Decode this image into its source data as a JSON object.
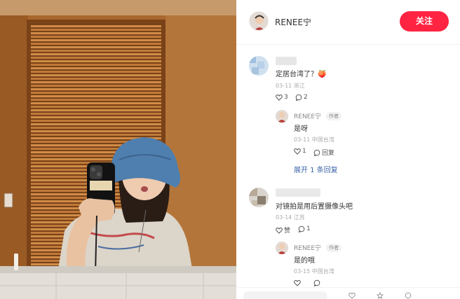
{
  "header": {
    "author_name": "RENEE宁",
    "follow_label": "关注"
  },
  "comments": [
    {
      "text": "定居台湾了？🍑",
      "date": "03-11",
      "location": "浙江",
      "likes": "3",
      "replies": "2",
      "reply": {
        "name": "RENEE宁",
        "tag": "作者",
        "text": "是呀",
        "date": "03-11",
        "location": "中国台湾",
        "likes": "1",
        "reply_label": "回复"
      },
      "expand_label": "展开 1 条回复"
    },
    {
      "text": "对镜拍是用后置摄像头吧",
      "date": "03-14",
      "location": "江苏",
      "likes": "赞",
      "replies": "1",
      "reply": {
        "name": "RENEE宁",
        "tag": "作者",
        "text": "是的哦",
        "date": "03-15",
        "location": "中国台湾",
        "likes": "",
        "reply_label": ""
      }
    }
  ],
  "icons": [
    "heart-icon",
    "comment-icon"
  ],
  "colors": {
    "accent": "#ff2442",
    "link": "#3a64a8"
  }
}
